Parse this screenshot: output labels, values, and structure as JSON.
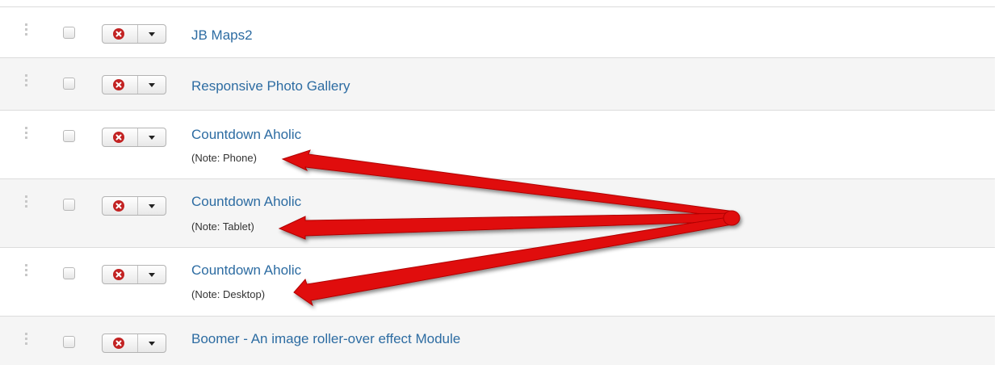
{
  "rows": [
    {
      "title": "JB Maps2",
      "note": ""
    },
    {
      "title": "Responsive Photo Gallery",
      "note": ""
    },
    {
      "title": "Countdown Aholic",
      "note": "(Note: Phone)"
    },
    {
      "title": "Countdown Aholic",
      "note": "(Note: Tablet)"
    },
    {
      "title": "Countdown Aholic",
      "note": "(Note: Desktop)"
    },
    {
      "title": "Boomer - An image roller-over effect Module",
      "note": ""
    }
  ],
  "icons": {
    "drag_handle": "drag-handle-icon",
    "status": "unpublished-icon",
    "toggle": "caret-down-icon"
  },
  "colors": {
    "link": "#2d6ca2",
    "status_icon": "#c22222",
    "annotation_arrow": "#e01010"
  }
}
